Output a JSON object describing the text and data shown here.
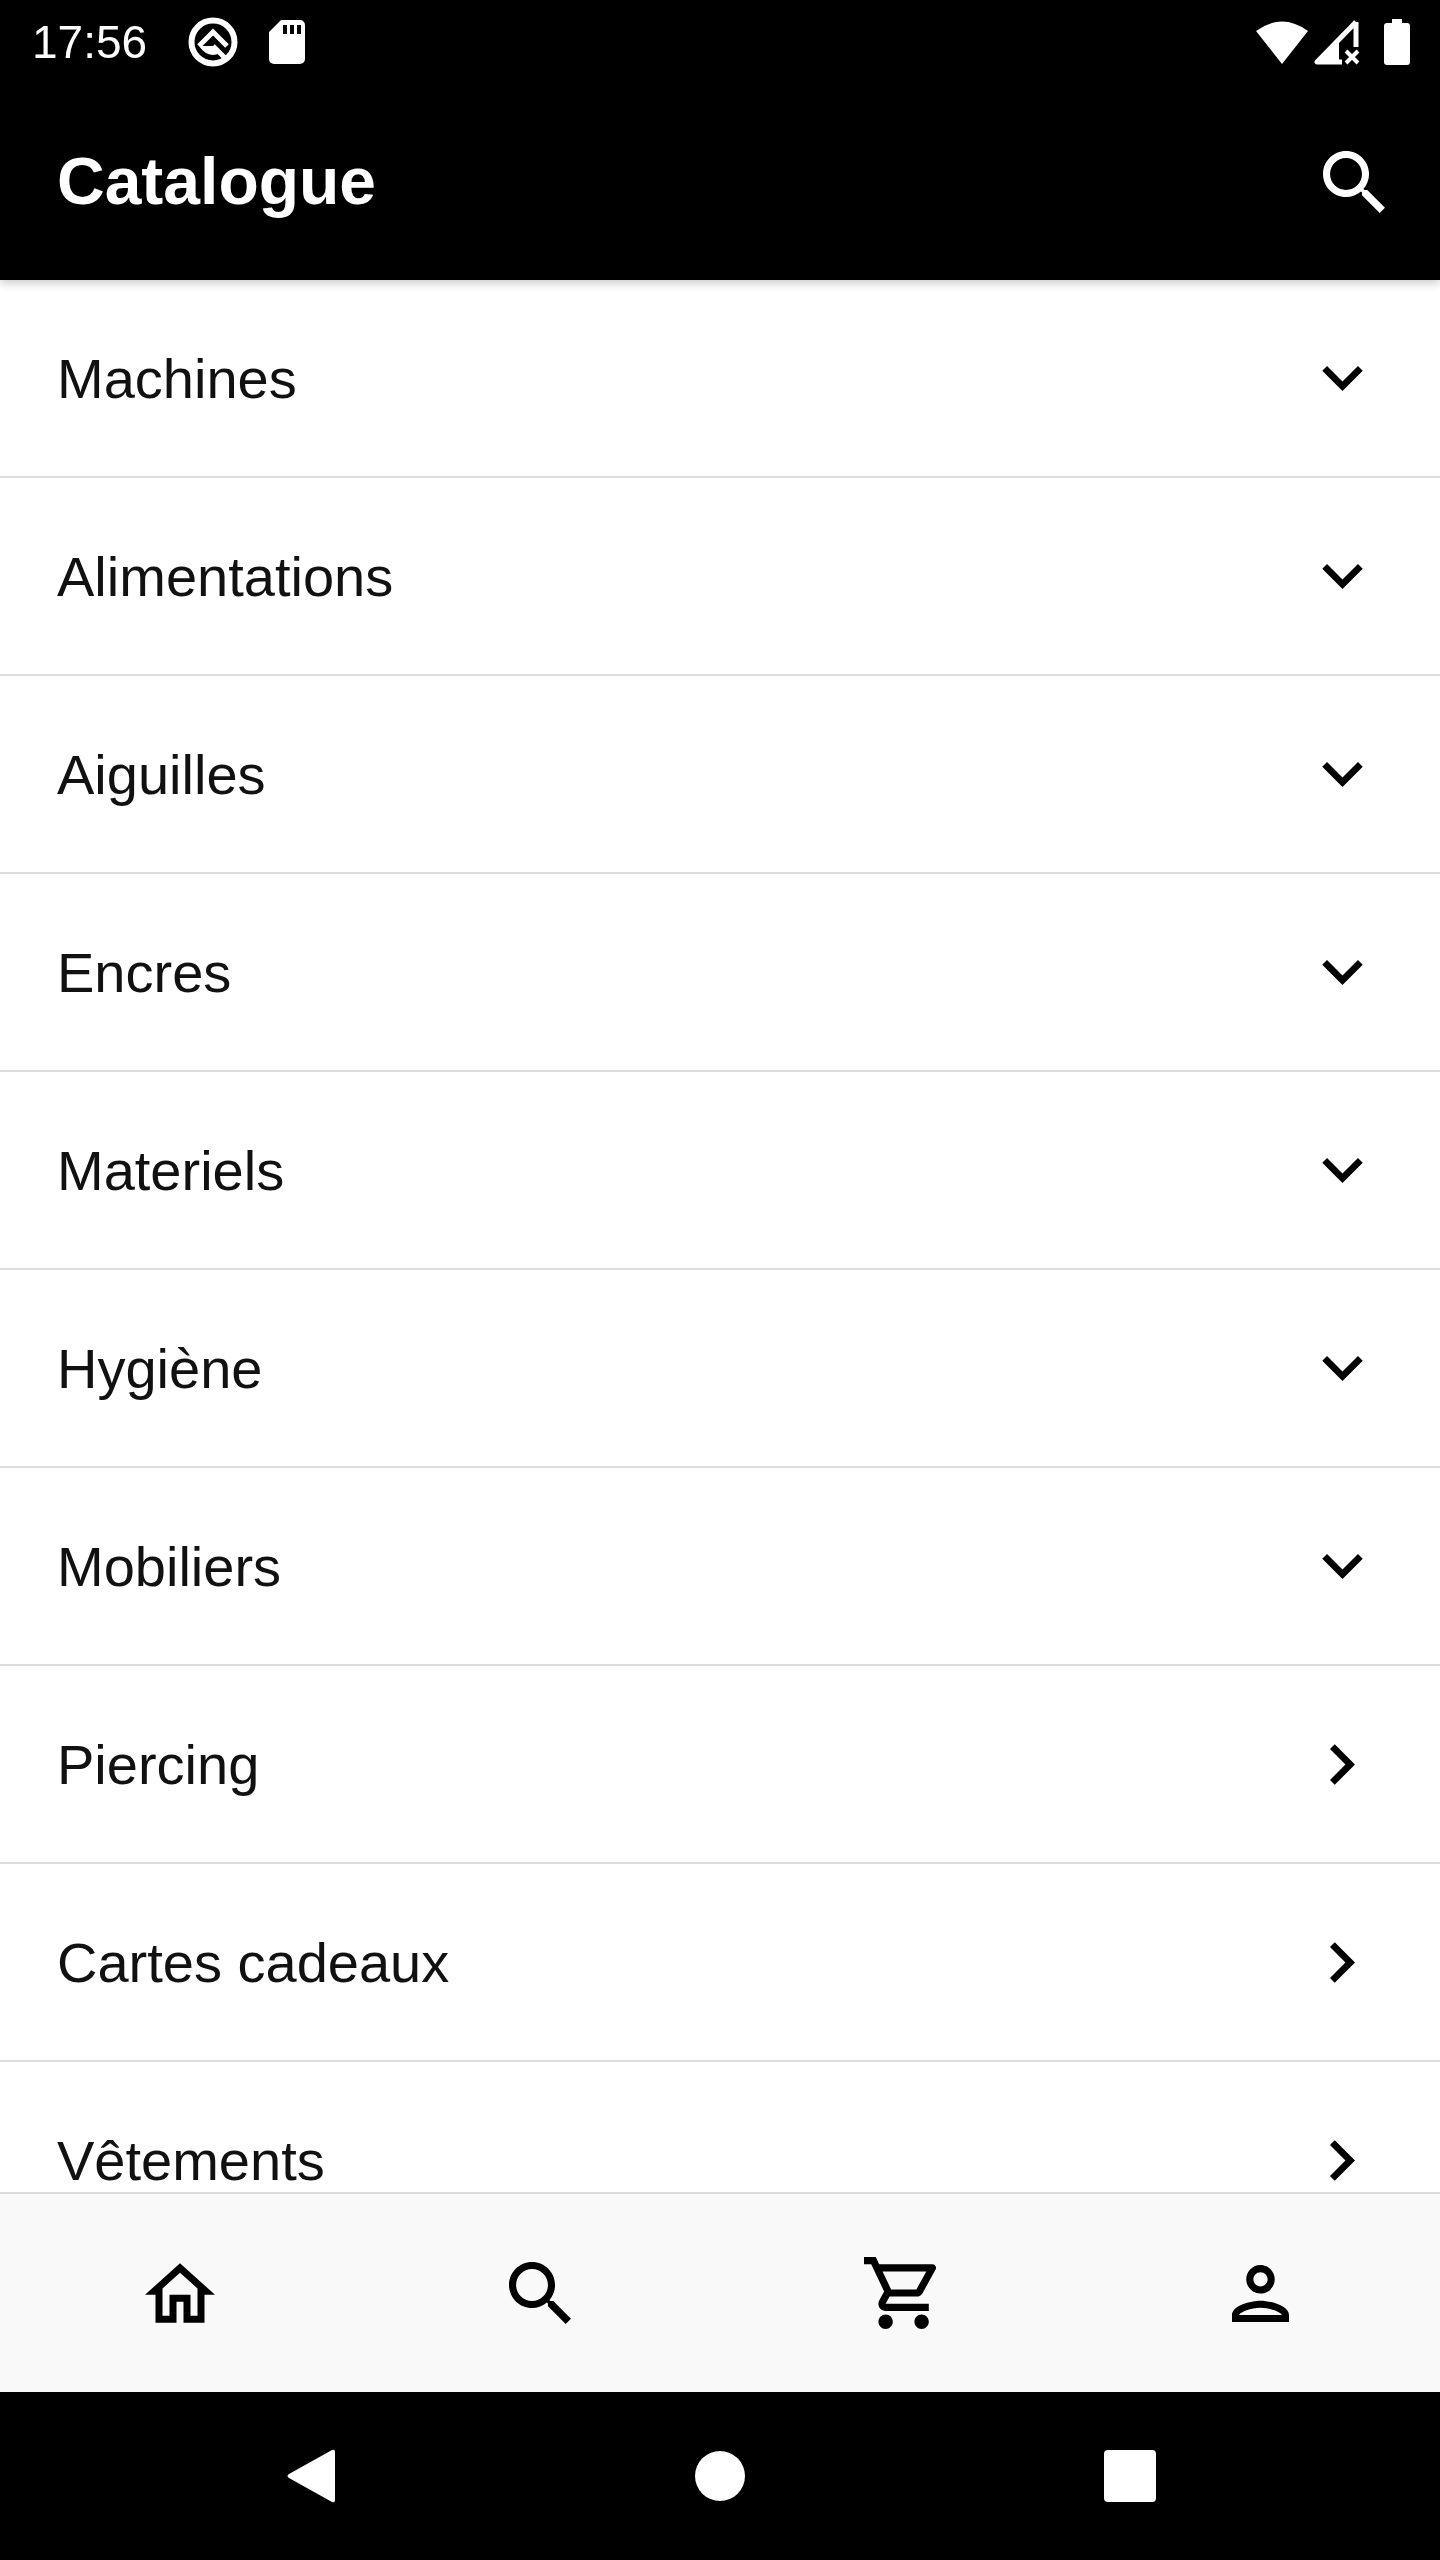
{
  "status_bar": {
    "time": "17:56"
  },
  "app_bar": {
    "title": "Catalogue"
  },
  "categories": [
    {
      "label": "Machines",
      "kind": "expandable"
    },
    {
      "label": "Alimentations",
      "kind": "expandable"
    },
    {
      "label": "Aiguilles",
      "kind": "expandable"
    },
    {
      "label": "Encres",
      "kind": "expandable"
    },
    {
      "label": "Materiels",
      "kind": "expandable"
    },
    {
      "label": "Hygiène",
      "kind": "expandable"
    },
    {
      "label": "Mobiliers",
      "kind": "expandable"
    },
    {
      "label": "Piercing",
      "kind": "link"
    },
    {
      "label": "Cartes cadeaux",
      "kind": "link"
    },
    {
      "label": "Vêtements",
      "kind": "link"
    }
  ]
}
